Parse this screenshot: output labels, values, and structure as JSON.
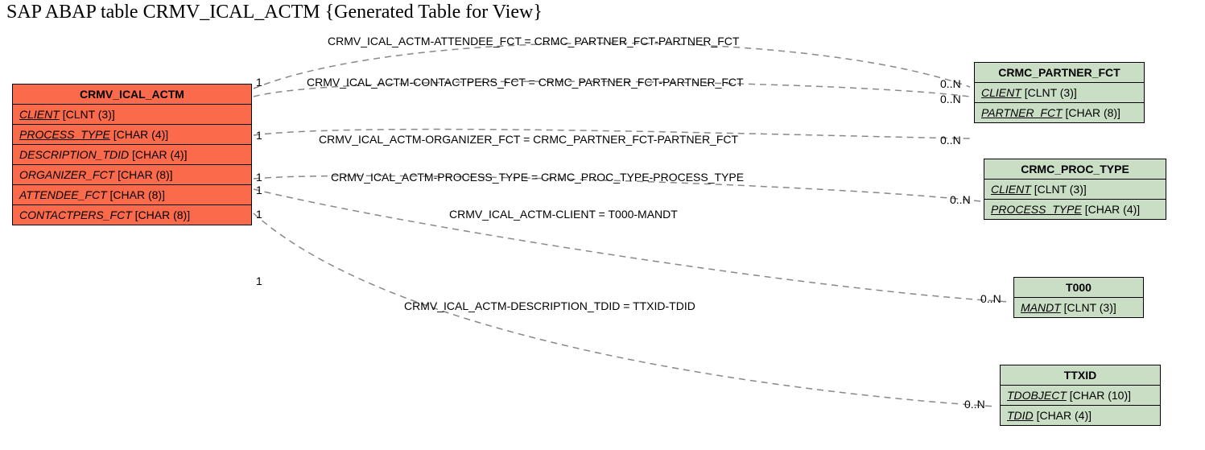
{
  "title": "SAP ABAP table CRMV_ICAL_ACTM {Generated Table for View}",
  "main": {
    "name": "CRMV_ICAL_ACTM",
    "fields": [
      {
        "name": "CLIENT",
        "type": "[CLNT (3)]",
        "pk": true
      },
      {
        "name": "PROCESS_TYPE",
        "type": "[CHAR (4)]",
        "pk": true
      },
      {
        "name": "DESCRIPTION_TDID",
        "type": "[CHAR (4)]",
        "fk": true
      },
      {
        "name": "ORGANIZER_FCT",
        "type": "[CHAR (8)]",
        "fk": true
      },
      {
        "name": "ATTENDEE_FCT",
        "type": "[CHAR (8)]",
        "fk": true
      },
      {
        "name": "CONTACTPERS_FCT",
        "type": "[CHAR (8)]",
        "fk": true
      }
    ]
  },
  "refs": {
    "partner_fct": {
      "name": "CRMC_PARTNER_FCT",
      "fields": [
        {
          "name": "CLIENT",
          "type": "[CLNT (3)]",
          "pk": true
        },
        {
          "name": "PARTNER_FCT",
          "type": "[CHAR (8)]",
          "pk": true
        }
      ]
    },
    "proc_type": {
      "name": "CRMC_PROC_TYPE",
      "fields": [
        {
          "name": "CLIENT",
          "type": "[CLNT (3)]",
          "pk": true
        },
        {
          "name": "PROCESS_TYPE",
          "type": "[CHAR (4)]",
          "pk": true
        }
      ]
    },
    "t000": {
      "name": "T000",
      "fields": [
        {
          "name": "MANDT",
          "type": "[CLNT (3)]",
          "pk": true
        }
      ]
    },
    "ttxid": {
      "name": "TTXID",
      "fields": [
        {
          "name": "TDOBJECT",
          "type": "[CHAR (10)]",
          "pk": true
        },
        {
          "name": "TDID",
          "type": "[CHAR (4)]",
          "pk": true
        }
      ]
    }
  },
  "rels": {
    "r1": "CRMV_ICAL_ACTM-ATTENDEE_FCT = CRMC_PARTNER_FCT-PARTNER_FCT",
    "r2": "CRMV_ICAL_ACTM-CONTACTPERS_FCT = CRMC_PARTNER_FCT-PARTNER_FCT",
    "r3": "CRMV_ICAL_ACTM-ORGANIZER_FCT = CRMC_PARTNER_FCT-PARTNER_FCT",
    "r4": "CRMV_ICAL_ACTM-PROCESS_TYPE = CRMC_PROC_TYPE-PROCESS_TYPE",
    "r5": "CRMV_ICAL_ACTM-CLIENT = T000-MANDT",
    "r6": "CRMV_ICAL_ACTM-DESCRIPTION_TDID = TTXID-TDID"
  },
  "cards": {
    "one": "1",
    "many": "0..N"
  }
}
